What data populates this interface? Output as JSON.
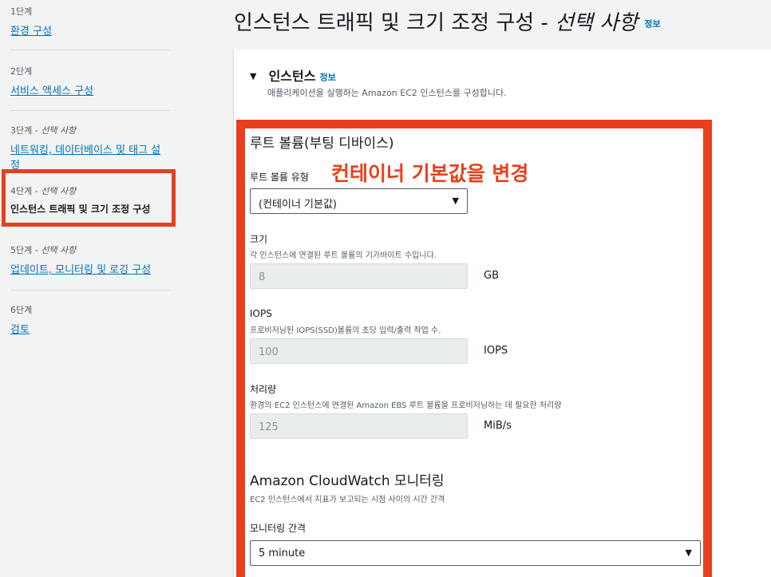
{
  "sidebar": {
    "steps": [
      {
        "num": "1단계",
        "label": "환경 구성"
      },
      {
        "num": "2단계",
        "label": "서비스 액세스 구성"
      },
      {
        "num": "3단계",
        "optional": "선택 사항",
        "label": "네트워킹, 데이터베이스 및 태그 설정"
      },
      {
        "num": "4단계",
        "optional": "선택 사항",
        "label": "인스턴스 트래픽 및 크기 조정 구성"
      },
      {
        "num": "5단계",
        "optional": "선택 사항",
        "label": "업데이트, 모니터링 및 로깅 구성"
      },
      {
        "num": "6단계",
        "label": "검토"
      }
    ]
  },
  "header": {
    "title": "인스턴스 트래픽 및 크기 조정 구성 -",
    "title_optional": "선택 사항",
    "info": "정보"
  },
  "panel": {
    "title": "인스턴스",
    "info": "정보",
    "description": "애플리케이션을 실행하는 Amazon EC2 인스턴스를 구성합니다."
  },
  "root_volume": {
    "section_title": "루트 볼륨(부팅 디바이스)",
    "type_label": "루트 볼륨 유형",
    "type_value": "(컨테이너 기본값)",
    "size_label": "크기",
    "size_desc": "각 인스턴스에 연결된 루트 볼륨의 기가바이트 수입니다.",
    "size_value": "8",
    "size_unit": "GB",
    "iops_label": "IOPS",
    "iops_desc": "프로비저닝된 IOPS(SSD)볼륨의 초당 입력/출력 작업 수.",
    "iops_value": "100",
    "iops_unit": "IOPS",
    "throughput_label": "처리량",
    "throughput_desc": "환경의 EC2 인스턴스에 연결된 Amazon EBS 루트 볼륨을 프로비저닝하는 데 필요한 처리량",
    "throughput_value": "125",
    "throughput_unit": "MiB/s"
  },
  "cloudwatch": {
    "section_title": "Amazon CloudWatch 모니터링",
    "desc": "EC2 인스턴스에서 지표가 보고되는 시점 사이의 시간 간격",
    "interval_label": "모니터링 간격",
    "interval_value": "5 minute"
  },
  "annotation": "컨테이너 기본값을 변경",
  "colors": {
    "highlight": "#e8401c",
    "link": "#0073bb"
  }
}
